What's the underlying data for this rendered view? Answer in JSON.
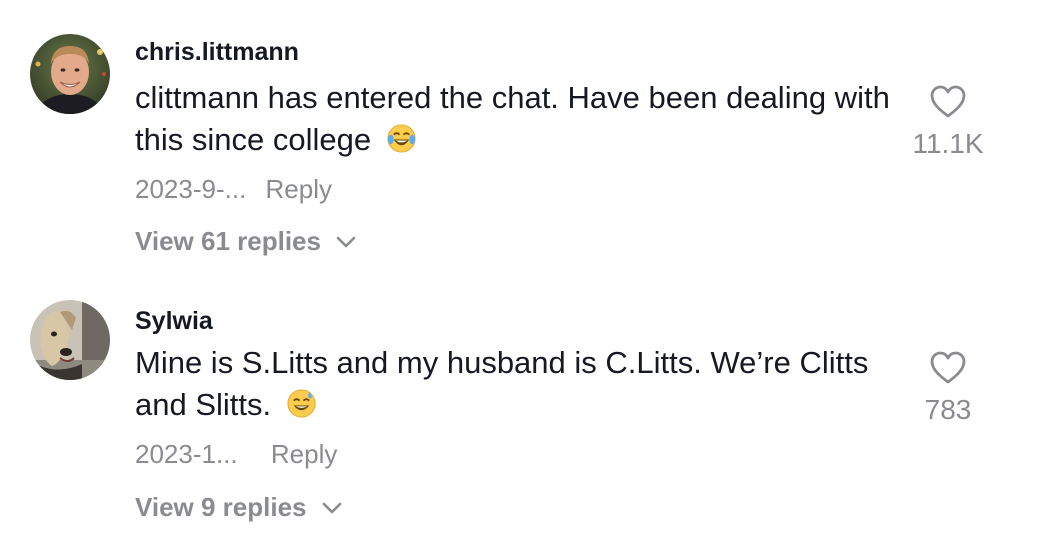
{
  "comments": [
    {
      "username": "chris.littmann",
      "text": "clittmann has entered the chat. Have been dealing with this since college",
      "emoji": "face-with-tears-of-joy",
      "date": "2023-9-...",
      "reply_label": "Reply",
      "view_replies": "View 61 replies",
      "likes": "11.1K"
    },
    {
      "username": "Sylwia",
      "text": "Mine is S.Litts and my husband is C.Litts. We’re Clitts and Slitts.",
      "emoji": "grinning-face-with-sweat",
      "date": "2023-1...",
      "reply_label": "Reply",
      "view_replies": "View 9 replies",
      "likes": "783"
    }
  ],
  "colors": {
    "text": "#161823",
    "secondary": "#8a8b91",
    "background": "#ffffff"
  }
}
